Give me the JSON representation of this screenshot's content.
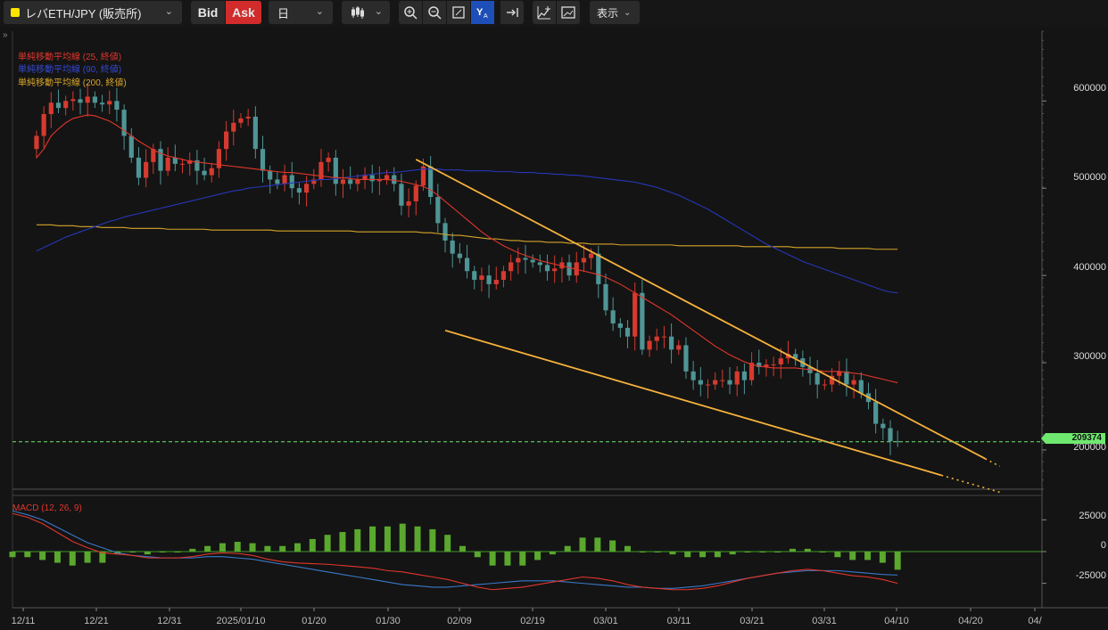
{
  "toolbar": {
    "symbol": "レバETH/JPY (販売所)",
    "bid": "Bid",
    "ask": "Ask",
    "timeframe": "日",
    "display": "表示",
    "colors": {
      "symbol_marker": "#ffe400",
      "ask_active": "#d12b2b",
      "y_active": "#1e4fb8"
    },
    "icons": [
      "candlestick-icon",
      "zoom-in-icon",
      "zoom-out-icon",
      "fit-icon",
      "auto-scale-y-icon",
      "jump-latest-icon",
      "add-indicator-icon",
      "screenshot-icon"
    ]
  },
  "legend": {
    "sma25": "単純移動平均線 (25, 終値)",
    "sma90": "単純移動平均線 (90, 終値)",
    "sma200": "単純移動平均線 (200, 終値)",
    "macd": "MACD (12, 26, 9)"
  },
  "price_tag": "209374",
  "price_axis": [
    "600000",
    "500000",
    "400000",
    "300000",
    "200000"
  ],
  "macd_axis": [
    "25000",
    "0",
    "-25000"
  ],
  "date_axis": [
    "12/11",
    "12/21",
    "12/31",
    "2025/01/10",
    "01/20",
    "01/30",
    "02/09",
    "02/19",
    "03/01",
    "03/11",
    "03/21",
    "03/31",
    "04/10",
    "04/20",
    "04/"
  ],
  "chart_data": {
    "type": "candlestick",
    "x_start": "2024-12-09",
    "x_end": "2025-04-05",
    "ylim": [
      155000,
      680000
    ],
    "current_price": 209374,
    "colors": {
      "up": "#d63a2f",
      "down": "#4f9596",
      "sma25": "#e0362c",
      "sma90": "#2637b8",
      "sma200": "#d6a52a",
      "trendline": "#f6b13c",
      "macd": "#e0362c",
      "signal": "#3a78c8",
      "hist": "#5aa82e"
    },
    "closes": [
      560000,
      585000,
      598000,
      592000,
      600000,
      602000,
      598000,
      605000,
      598000,
      596000,
      600000,
      590000,
      560000,
      535000,
      512000,
      530000,
      545000,
      520000,
      535000,
      528000,
      528000,
      532000,
      520000,
      515000,
      523000,
      545000,
      565000,
      575000,
      580000,
      582000,
      545000,
      520000,
      510000,
      505000,
      515000,
      500000,
      495000,
      505000,
      510000,
      530000,
      535000,
      505000,
      510000,
      505000,
      510000,
      515000,
      508000,
      510000,
      515000,
      505000,
      480000,
      485000,
      503000,
      525000,
      490000,
      460000,
      440000,
      425000,
      420000,
      405000,
      395000,
      400000,
      390000,
      395000,
      405000,
      415000,
      420000,
      418000,
      415000,
      412000,
      405000,
      408000,
      415000,
      400000,
      415000,
      420000,
      425000,
      390000,
      360000,
      345000,
      340000,
      330000,
      380000,
      315000,
      325000,
      330000,
      330000,
      315000,
      320000,
      290000,
      280000,
      275000,
      275000,
      280000,
      280000,
      275000,
      290000,
      280000,
      300000,
      295000,
      298000,
      298000,
      305000,
      310000,
      305000,
      295000,
      288000,
      275000,
      275000,
      285000,
      290000,
      275000,
      280000,
      265000,
      255000,
      230000,
      225000,
      210000,
      209374
    ],
    "sma25": [
      535000,
      545000,
      560000,
      568000,
      575000,
      580000,
      582000,
      584000,
      583000,
      580000,
      577000,
      572000,
      566000,
      560000,
      554000,
      549000,
      544000,
      540000,
      537000,
      535000,
      533000,
      531000,
      530000,
      529000,
      528000,
      527000,
      526000,
      525000,
      524000,
      523000,
      522000,
      521000,
      520000,
      519000,
      518000,
      518000,
      517000,
      516000,
      515000,
      514000,
      513000,
      512000,
      512000,
      511000,
      510000,
      510000,
      510000,
      510000,
      510000,
      509000,
      508000,
      506000,
      504000,
      502000,
      498000,
      492000,
      485000,
      478000,
      471000,
      464000,
      457000,
      450000,
      444000,
      439000,
      434000,
      430000,
      426000,
      423000,
      420000,
      417000,
      415000,
      413000,
      411000,
      409000,
      407000,
      405000,
      403000,
      401000,
      398000,
      394000,
      390000,
      385000,
      380000,
      375000,
      370000,
      365000,
      360000,
      355000,
      349000,
      343000,
      337000,
      331000,
      325000,
      319000,
      314000,
      309000,
      305000,
      301000,
      298000,
      296000,
      295000,
      294000,
      294000,
      294000,
      294000,
      293000,
      292000,
      291000,
      290000,
      290000,
      290000,
      289000,
      288000,
      287000,
      285000,
      283000,
      281000,
      279000,
      277000
    ],
    "sma90": [
      428000,
      432000,
      436000,
      440000,
      444000,
      447000,
      450000,
      453000,
      456000,
      459000,
      462000,
      464000,
      467000,
      469000,
      471000,
      473000,
      475000,
      477000,
      479000,
      481000,
      483000,
      485000,
      487000,
      489000,
      491000,
      493000,
      495000,
      497000,
      498000,
      500000,
      501000,
      502000,
      503000,
      504000,
      505000,
      506000,
      507000,
      508000,
      509000,
      510000,
      510000,
      511000,
      512000,
      513000,
      514000,
      515000,
      516000,
      517000,
      518000,
      518000,
      519000,
      520000,
      521000,
      522000,
      522000,
      522000,
      521000,
      521000,
      521000,
      520000,
      520000,
      520000,
      520000,
      519000,
      519000,
      519000,
      518000,
      518000,
      518000,
      517000,
      517000,
      516000,
      516000,
      515000,
      515000,
      514000,
      513000,
      512000,
      511000,
      510000,
      509000,
      508000,
      507000,
      505000,
      503000,
      501000,
      498000,
      495000,
      492000,
      488000,
      484000,
      480000,
      476000,
      471000,
      466000,
      461000,
      456000,
      451000,
      446000,
      441000,
      436000,
      432000,
      428000,
      424000,
      420000,
      416000,
      413000,
      410000,
      407000,
      404000,
      401000,
      398000,
      395000,
      392000,
      389000,
      386000,
      383000,
      381000,
      380000
    ],
    "sma200": [
      458000,
      458000,
      458000,
      457000,
      457000,
      457000,
      456000,
      456000,
      456000,
      455000,
      455000,
      455000,
      455000,
      454000,
      454000,
      454000,
      454000,
      454000,
      453000,
      453000,
      453000,
      453000,
      453000,
      453000,
      452000,
      452000,
      452000,
      452000,
      452000,
      452000,
      452000,
      452000,
      452000,
      451000,
      451000,
      451000,
      451000,
      451000,
      451000,
      451000,
      451000,
      451000,
      451000,
      451000,
      450000,
      450000,
      450000,
      450000,
      450000,
      450000,
      450000,
      450000,
      450000,
      449000,
      449000,
      448000,
      447000,
      446000,
      446000,
      445000,
      444000,
      443000,
      442000,
      442000,
      441000,
      440000,
      440000,
      439000,
      439000,
      439000,
      438000,
      438000,
      438000,
      437000,
      437000,
      437000,
      436000,
      436000,
      436000,
      436000,
      435000,
      435000,
      435000,
      435000,
      435000,
      435000,
      435000,
      435000,
      434000,
      434000,
      434000,
      434000,
      434000,
      434000,
      434000,
      434000,
      434000,
      433000,
      433000,
      433000,
      433000,
      433000,
      433000,
      433000,
      432000,
      432000,
      432000,
      432000,
      432000,
      432000,
      431000,
      431000,
      431000,
      431000,
      431000,
      430000,
      430000,
      430000,
      430000
    ],
    "trendlines": [
      {
        "x1": "2025-01-30",
        "y1": 533000,
        "x2": "2025-04-18",
        "y2": 190000,
        "extend_dotted_to": "2025-04-20"
      },
      {
        "x1": "2025-02-03",
        "y1": 337000,
        "x2": "2025-04-12",
        "y2": 171000,
        "extend_dotted_to": "2025-04-20"
      }
    ],
    "macd": {
      "ylim": [
        -40000,
        40000
      ],
      "macd": [
        30000,
        27000,
        22000,
        15000,
        8000,
        3000,
        -1000,
        -2000,
        -3000,
        -5000,
        -5000,
        -5000,
        -4000,
        -2000,
        -1000,
        -1500,
        -3000,
        -6000,
        -8000,
        -9000,
        -9500,
        -10000,
        -11000,
        -12000,
        -13000,
        -15000,
        -16000,
        -18000,
        -20000,
        -22000,
        -25000,
        -28000,
        -30000,
        -29000,
        -28000,
        -26000,
        -24000,
        -22000,
        -20000,
        -21000,
        -23000,
        -26000,
        -28000,
        -29000,
        -30000,
        -30000,
        -29000,
        -27000,
        -24000,
        -21000,
        -19000,
        -17000,
        -15000,
        -14000,
        -15000,
        -17000,
        -19000,
        -20000,
        -22000,
        -25000
      ],
      "signal": [
        32000,
        29000,
        25000,
        19000,
        13000,
        7000,
        3000,
        -1000,
        -3000,
        -4000,
        -5000,
        -5000,
        -5000,
        -4000,
        -4000,
        -5000,
        -6000,
        -8000,
        -10000,
        -12000,
        -14000,
        -16000,
        -18000,
        -20000,
        -22000,
        -24000,
        -26000,
        -27000,
        -28000,
        -28000,
        -27000,
        -26000,
        -25000,
        -24000,
        -23000,
        -23000,
        -23000,
        -24000,
        -25000,
        -26000,
        -27000,
        -28000,
        -28000,
        -29000,
        -29000,
        -28000,
        -27000,
        -25000,
        -23000,
        -21000,
        -19000,
        -17000,
        -16000,
        -15000,
        -15000,
        -15000,
        -16000,
        -17000,
        -18000,
        -18500
      ]
    }
  }
}
